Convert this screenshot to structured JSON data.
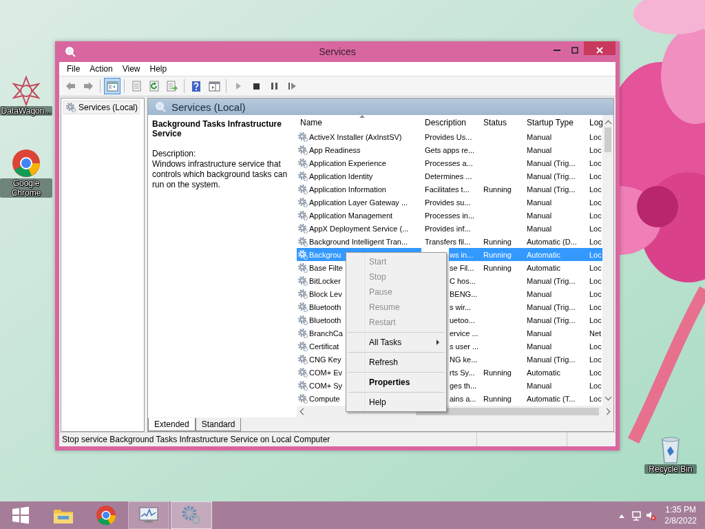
{
  "desktop_icons": [
    {
      "label": "DataWagon...",
      "kind": "star"
    },
    {
      "label": "Google Chrome",
      "kind": "chrome"
    },
    {
      "label": "Recycle Bin",
      "kind": "bin"
    }
  ],
  "window": {
    "title": "Services"
  },
  "menu_bar": [
    "File",
    "Action",
    "View",
    "Help"
  ],
  "toolbar": [
    {
      "kind": "back",
      "pressed": false
    },
    {
      "kind": "forward",
      "pressed": false
    },
    {
      "kind": "separator"
    },
    {
      "kind": "console_tree",
      "pressed": true
    },
    {
      "kind": "separator"
    },
    {
      "kind": "properties",
      "pressed": false
    },
    {
      "kind": "refresh",
      "pressed": false
    },
    {
      "kind": "export",
      "pressed": false
    },
    {
      "kind": "separator"
    },
    {
      "kind": "help",
      "pressed": false
    },
    {
      "kind": "action_pane",
      "pressed": false
    },
    {
      "kind": "separator"
    },
    {
      "kind": "start",
      "pressed": false
    },
    {
      "kind": "stop",
      "pressed": false
    },
    {
      "kind": "pause",
      "pressed": false
    },
    {
      "kind": "restart",
      "pressed": false
    }
  ],
  "tree": [
    {
      "label": "Services (Local)",
      "selected": true
    }
  ],
  "panel": {
    "title": "Services (Local)"
  },
  "details": {
    "service_name": "Background Tasks Infrastructure Service",
    "description_label": "Description:",
    "description": "Windows infrastructure service that controls which background tasks can run on the system."
  },
  "table": {
    "columns": [
      {
        "label": "Name",
        "sorted": true
      },
      {
        "label": "Description",
        "sorted": false
      },
      {
        "label": "Status",
        "sorted": false
      },
      {
        "label": "Startup Type",
        "sorted": false
      },
      {
        "label": "Log",
        "sorted": false
      }
    ],
    "rows": [
      {
        "name": "ActiveX Installer (AxInstSV)",
        "description": "Provides Us...",
        "startup": "Manual",
        "log": "Loc",
        "selected": false,
        "covered": false
      },
      {
        "name": "App Readiness",
        "description": "Gets apps re...",
        "startup": "Manual",
        "log": "Loc",
        "selected": false,
        "covered": false
      },
      {
        "name": "Application Experience",
        "description": "Processes a...",
        "startup": "Manual (Trig...",
        "log": "Loc",
        "selected": false,
        "covered": false
      },
      {
        "name": "Application Identity",
        "description": "Determines ...",
        "startup": "Manual (Trig...",
        "log": "Loc",
        "selected": false,
        "covered": false
      },
      {
        "name": "Application Information",
        "description": "Facilitates t...",
        "status": "Running",
        "startup": "Manual (Trig...",
        "log": "Loc",
        "selected": false,
        "covered": false
      },
      {
        "name": "Application Layer Gateway ...",
        "description": "Provides su...",
        "startup": "Manual",
        "log": "Loc",
        "selected": false,
        "covered": false
      },
      {
        "name": "Application Management",
        "description": "Processes in...",
        "startup": "Manual",
        "log": "Loc",
        "selected": false,
        "covered": false
      },
      {
        "name": "AppX Deployment Service (...",
        "description": "Provides inf...",
        "startup": "Manual",
        "log": "Loc",
        "selected": false,
        "covered": false
      },
      {
        "name": "Background Intelligent Tran...",
        "description": "Transfers fil...",
        "status": "Running",
        "startup": "Automatic (D...",
        "log": "Loc",
        "selected": false,
        "covered": false
      },
      {
        "name": "Backgrou",
        "description": "ws in...",
        "status": "Running",
        "startup": "Automatic",
        "log": "Loc",
        "selected": true,
        "covered": true
      },
      {
        "name": "Base Filte",
        "description": "se Fil...",
        "status": "Running",
        "startup": "Automatic",
        "log": "Loc",
        "selected": false,
        "covered": true
      },
      {
        "name": "BitLocker",
        "description": "C hos...",
        "startup": "Manual (Trig...",
        "log": "Loc",
        "selected": false,
        "covered": true
      },
      {
        "name": "Block Lev",
        "description": "BENG...",
        "startup": "Manual",
        "log": "Loc",
        "selected": false,
        "covered": true
      },
      {
        "name": "Bluetooth",
        "description": "s wir...",
        "startup": "Manual (Trig...",
        "log": "Loc",
        "selected": false,
        "covered": true
      },
      {
        "name": "Bluetooth",
        "description": "uetoo...",
        "startup": "Manual (Trig...",
        "log": "Loc",
        "selected": false,
        "covered": true
      },
      {
        "name": "BranchCa",
        "description": "ervice ...",
        "startup": "Manual",
        "log": "Net",
        "selected": false,
        "covered": true
      },
      {
        "name": "Certificat",
        "description": "s user ...",
        "startup": "Manual",
        "log": "Loc",
        "selected": false,
        "covered": true
      },
      {
        "name": "CNG Key",
        "description": "NG ke...",
        "startup": "Manual (Trig...",
        "log": "Loc",
        "selected": false,
        "covered": true
      },
      {
        "name": "COM+ Ev",
        "description": "rts Sy...",
        "status": "Running",
        "startup": "Automatic",
        "log": "Loc",
        "selected": false,
        "covered": true
      },
      {
        "name": "COM+ Sy",
        "description": "ges th...",
        "startup": "Manual",
        "log": "Loc",
        "selected": false,
        "covered": true
      },
      {
        "name": "Compute",
        "description": "ains a...",
        "status": "Running",
        "startup": "Automatic (T...",
        "log": "Loc",
        "selected": false,
        "covered": true
      }
    ]
  },
  "context_menu": {
    "groups": [
      [
        {
          "label": "Start",
          "disabled": true,
          "submenu": false,
          "default": false
        },
        {
          "label": "Stop",
          "disabled": true,
          "submenu": false,
          "default": false
        },
        {
          "label": "Pause",
          "disabled": true,
          "submenu": false,
          "default": false
        },
        {
          "label": "Resume",
          "disabled": true,
          "submenu": false,
          "default": false
        },
        {
          "label": "Restart",
          "disabled": true,
          "submenu": false,
          "default": false
        }
      ],
      [
        {
          "label": "All Tasks",
          "disabled": false,
          "submenu": true,
          "default": false
        }
      ],
      [
        {
          "label": "Refresh",
          "disabled": false,
          "submenu": false,
          "default": false
        }
      ],
      [
        {
          "label": "Properties",
          "disabled": false,
          "submenu": false,
          "default": true
        }
      ],
      [
        {
          "label": "Help",
          "disabled": false,
          "submenu": false,
          "default": false
        }
      ]
    ]
  },
  "view_tabs": [
    {
      "label": "Extended",
      "selected": true
    },
    {
      "label": "Standard",
      "selected": false
    }
  ],
  "status_bar": "Stop service Background Tasks Infrastructure Service on Local Computer",
  "taskbar": {
    "apps": [
      {
        "kind": "start",
        "open": false,
        "selected": false
      },
      {
        "kind": "explorer",
        "open": false,
        "selected": false
      },
      {
        "kind": "chrome",
        "open": false,
        "selected": false
      },
      {
        "kind": "monitor",
        "open": true,
        "selected": false
      },
      {
        "kind": "services",
        "open": true,
        "selected": true
      }
    ],
    "tray": [
      {
        "kind": "up"
      },
      {
        "kind": "network"
      },
      {
        "kind": "volume_muted"
      }
    ],
    "clock": {
      "time": "1:35 PM",
      "date": "2/8/2022"
    }
  }
}
